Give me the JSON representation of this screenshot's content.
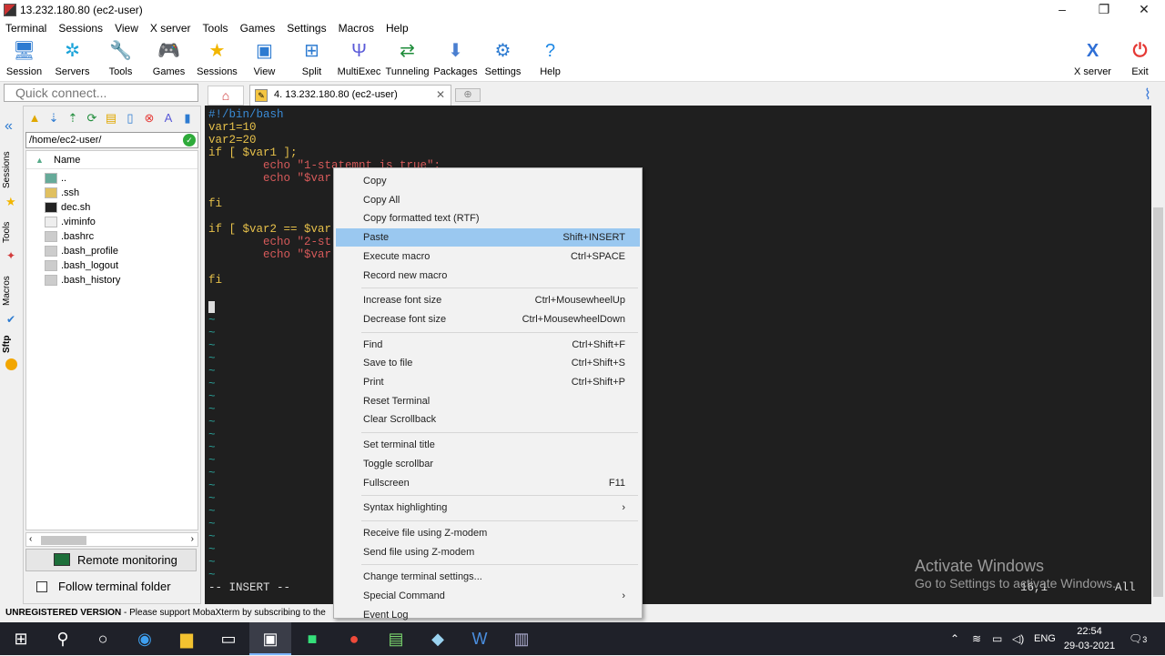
{
  "window": {
    "title": "13.232.180.80 (ec2-user)",
    "min": "–",
    "max": "❐",
    "close": "✕"
  },
  "menu": [
    "Terminal",
    "Sessions",
    "View",
    "X server",
    "Tools",
    "Games",
    "Settings",
    "Macros",
    "Help"
  ],
  "toolbar": {
    "items": [
      {
        "label": "Session",
        "icon": "monitor-icon",
        "color": "#2d7bd1",
        "glyph": "🖥"
      },
      {
        "label": "Servers",
        "icon": "servers-icon",
        "color": "#1aa3d9",
        "glyph": "✲"
      },
      {
        "label": "Tools",
        "icon": "tools-icon",
        "color": "#d23b3b",
        "glyph": "🔧"
      },
      {
        "label": "Games",
        "icon": "games-icon",
        "color": "#555",
        "glyph": "🎮"
      },
      {
        "label": "Sessions",
        "icon": "star-icon",
        "color": "#f2b600",
        "glyph": "★"
      },
      {
        "label": "View",
        "icon": "view-icon",
        "color": "#2d7bd1",
        "glyph": "▣"
      },
      {
        "label": "Split",
        "icon": "split-icon",
        "color": "#2d7bd1",
        "glyph": "⊞"
      },
      {
        "label": "MultiExec",
        "icon": "multiexec-icon",
        "color": "#5a5ad8",
        "glyph": "Ψ"
      },
      {
        "label": "Tunneling",
        "icon": "tunneling-icon",
        "color": "#1e8c3a",
        "glyph": "⇄"
      },
      {
        "label": "Packages",
        "icon": "packages-icon",
        "color": "#4a7fd0",
        "glyph": "⬇"
      },
      {
        "label": "Settings",
        "icon": "settings-icon",
        "color": "#2d7bd1",
        "glyph": "⚙"
      },
      {
        "label": "Help",
        "icon": "help-icon",
        "color": "#1e88e5",
        "glyph": "?"
      }
    ],
    "xserver": {
      "label": "X server",
      "icon": "x-server-icon",
      "color": "#2f6fd6"
    },
    "exit": {
      "label": "Exit",
      "icon": "power-icon",
      "color": "#e53935"
    }
  },
  "quick_connect": {
    "placeholder": "Quick connect..."
  },
  "tab": {
    "label": "4. 13.232.180.80 (ec2-user)"
  },
  "sidebar_tabs": [
    "Sessions",
    "Tools",
    "Macros",
    "Sftp"
  ],
  "sftp": {
    "path": "/home/ec2-user/",
    "column": "Name",
    "files": [
      "..",
      ".ssh",
      "dec.sh",
      ".viminfo",
      ".bashrc",
      ".bash_profile",
      ".bash_logout",
      ".bash_history"
    ],
    "remote_monitoring": "Remote monitoring",
    "follow_folder": "Follow terminal folder"
  },
  "terminal": {
    "lines": [
      {
        "t": "#!/bin/bash",
        "c": "#3a8bd6"
      },
      {
        "t": "var1=10",
        "c": "#e6c04a"
      },
      {
        "t": "var2=20",
        "c": "#e6c04a"
      },
      {
        "t": "if [ $var1 ];",
        "c": "#e6c04a"
      },
      {
        "t": "        echo \"1-statemnt is true\";",
        "c": "#d65a5a"
      },
      {
        "t": "        echo \"$var",
        "c": "#d65a5a"
      },
      {
        "t": "",
        "c": "#ccc"
      },
      {
        "t": "fi",
        "c": "#e6c04a"
      },
      {
        "t": "",
        "c": "#ccc"
      },
      {
        "t": "if [ $var2 == $var",
        "c": "#e6c04a"
      },
      {
        "t": "        echo \"2-st",
        "c": "#d65a5a"
      },
      {
        "t": "        echo \"$var",
        "c": "#d65a5a"
      },
      {
        "t": "",
        "c": "#ccc"
      },
      {
        "t": "fi",
        "c": "#e6c04a"
      }
    ],
    "tilde": "~",
    "mode": "-- INSERT --",
    "position": "16,1",
    "scroll_pos": "All"
  },
  "context_menu": {
    "groups": [
      [
        {
          "label": "Copy",
          "shortcut": ""
        },
        {
          "label": "Copy All",
          "shortcut": ""
        },
        {
          "label": "Copy formatted text (RTF)",
          "shortcut": ""
        },
        {
          "label": "Paste",
          "shortcut": "Shift+INSERT",
          "highlight": true
        },
        {
          "label": "Execute macro",
          "shortcut": "Ctrl+SPACE"
        },
        {
          "label": "Record new macro",
          "shortcut": ""
        }
      ],
      [
        {
          "label": "Increase font size",
          "shortcut": "Ctrl+MousewheelUp"
        },
        {
          "label": "Decrease font size",
          "shortcut": "Ctrl+MousewheelDown"
        }
      ],
      [
        {
          "label": "Find",
          "shortcut": "Ctrl+Shift+F"
        },
        {
          "label": "Save to file",
          "shortcut": "Ctrl+Shift+S"
        },
        {
          "label": "Print",
          "shortcut": "Ctrl+Shift+P"
        },
        {
          "label": "Reset Terminal",
          "shortcut": ""
        },
        {
          "label": "Clear Scrollback",
          "shortcut": ""
        }
      ],
      [
        {
          "label": "Set terminal title",
          "shortcut": ""
        },
        {
          "label": "Toggle scrollbar",
          "shortcut": ""
        },
        {
          "label": "Fullscreen",
          "shortcut": "F11"
        }
      ],
      [
        {
          "label": "Syntax highlighting",
          "shortcut": "›"
        }
      ],
      [
        {
          "label": "Receive file using Z-modem",
          "shortcut": ""
        },
        {
          "label": "Send file using Z-modem",
          "shortcut": ""
        }
      ],
      [
        {
          "label": "Change terminal settings...",
          "shortcut": ""
        },
        {
          "label": "Special Command",
          "shortcut": "›"
        },
        {
          "label": "Event Log",
          "shortcut": ""
        }
      ]
    ]
  },
  "status": {
    "version": "UNREGISTERED VERSION",
    "message": " -  Please support MobaXterm by subscribing to the"
  },
  "watermark": {
    "title": "Activate Windows",
    "subtitle": "Go to Settings to activate Windows."
  },
  "taskbar": {
    "lang": "ENG",
    "time": "22:54",
    "date": "29-03-2021",
    "notif": "3"
  }
}
